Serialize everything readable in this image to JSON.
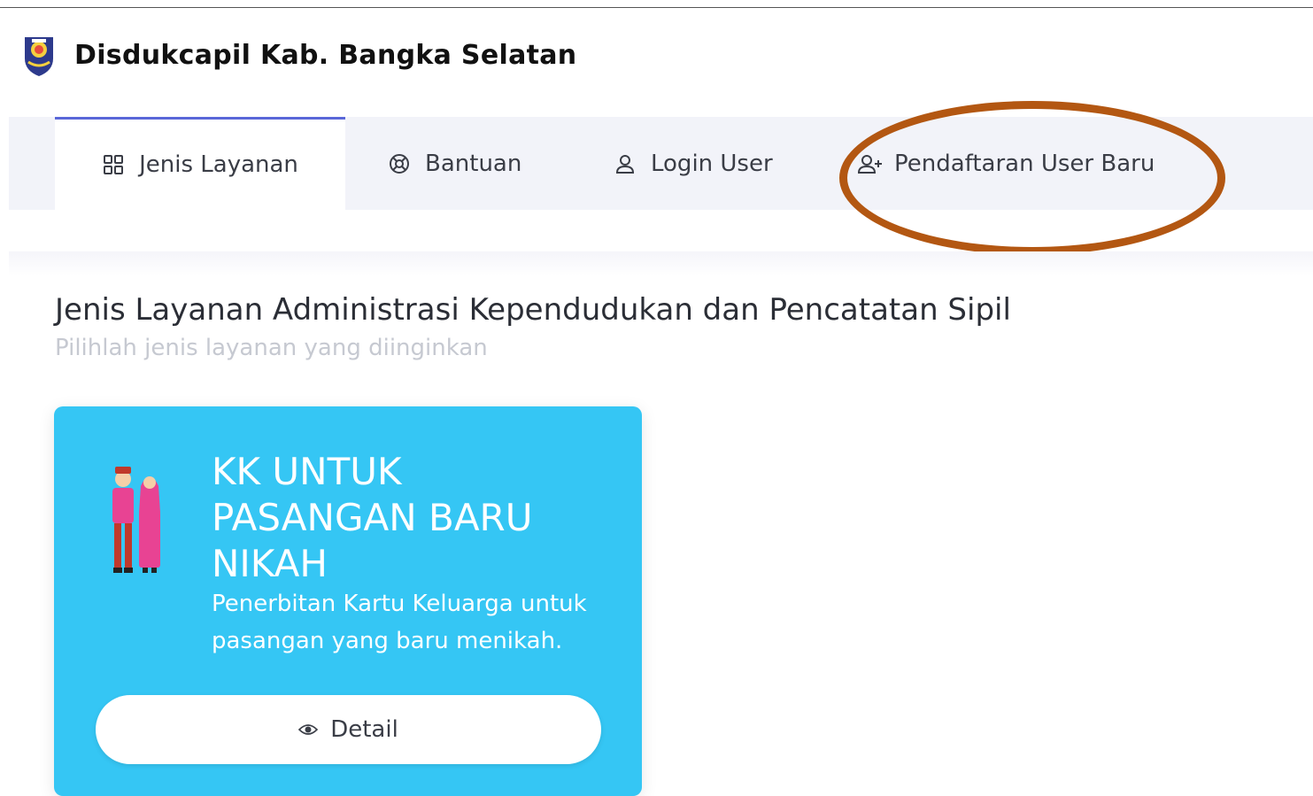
{
  "header": {
    "title": "Disdukcapil Kab. Bangka Selatan"
  },
  "nav": {
    "items": [
      {
        "label": "Jenis Layanan",
        "icon": "grid-icon",
        "active": true
      },
      {
        "label": "Bantuan",
        "icon": "lifebuoy-icon",
        "active": false
      },
      {
        "label": "Login User",
        "icon": "user-icon",
        "active": false
      },
      {
        "label": "Pendaftaran User Baru",
        "icon": "user-plus-icon",
        "active": false
      }
    ]
  },
  "main": {
    "title": "Jenis Layanan Administrasi Kependudukan dan Pencatatan Sipil",
    "subtitle": "Pilihlah jenis layanan yang diinginkan",
    "cards": [
      {
        "title": "KK UNTUK PASANGAN BARU NIKAH",
        "description": "Penerbitan Kartu Keluarga untuk pasangan yang baru menikah.",
        "button_label": "Detail",
        "button_icon": "eye-icon"
      }
    ]
  },
  "colors": {
    "accent": "#5a67d8",
    "card_bg": "#35c6f4",
    "nav_bg": "#f2f3f9",
    "highlight_ring": "#b35712"
  }
}
